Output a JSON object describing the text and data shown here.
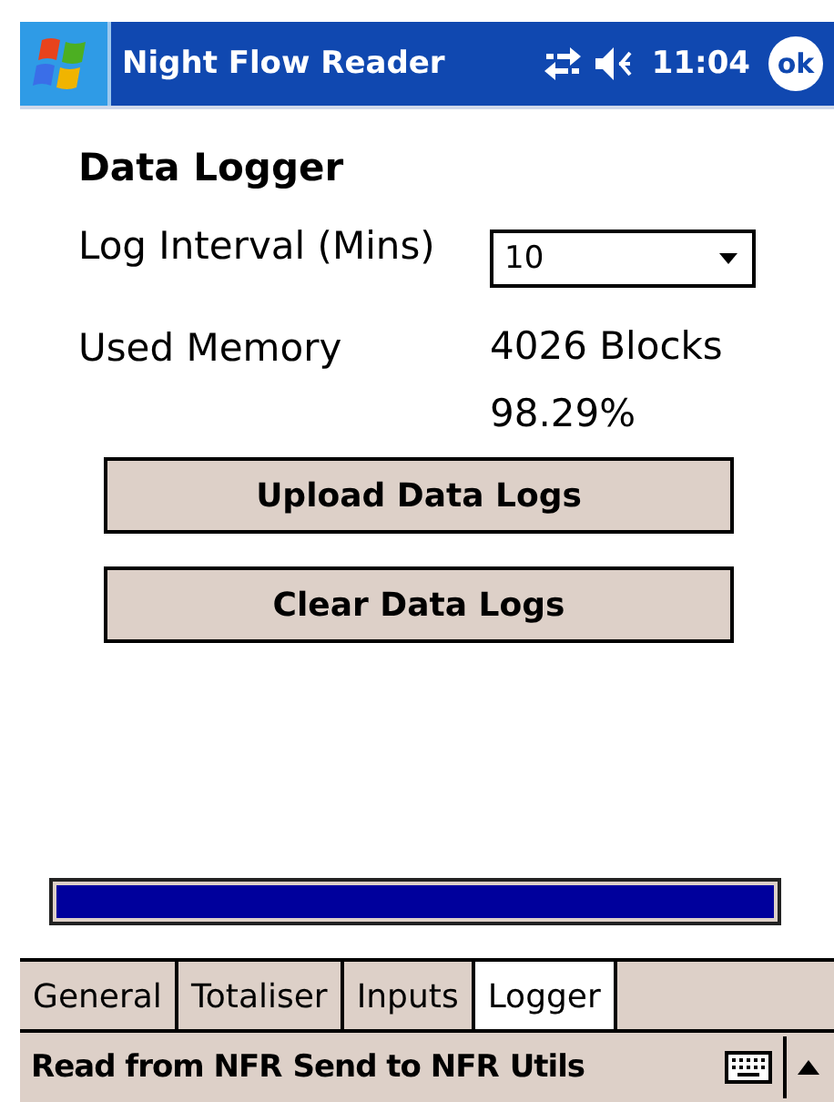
{
  "title_bar": {
    "title": "Night Flow Reader",
    "time": "11:04",
    "ok": "ok"
  },
  "heading": "Data Logger",
  "log_interval": {
    "label": "Log Interval (Mins)",
    "value": "10"
  },
  "used_memory": {
    "label": "Used Memory",
    "blocks": "4026 Blocks",
    "percent": "98.29%"
  },
  "buttons": [
    "Upload Data Logs",
    "Clear Data Logs"
  ],
  "progress": {
    "level": 1
  },
  "tabs": [
    {
      "label": "General",
      "selected": false
    },
    {
      "label": "Totaliser",
      "selected": false
    },
    {
      "label": "Inputs",
      "selected": false
    },
    {
      "label": "Logger",
      "selected": true
    }
  ],
  "menu": [
    "Read from NFR",
    "Send to NFR",
    "Utils"
  ]
}
